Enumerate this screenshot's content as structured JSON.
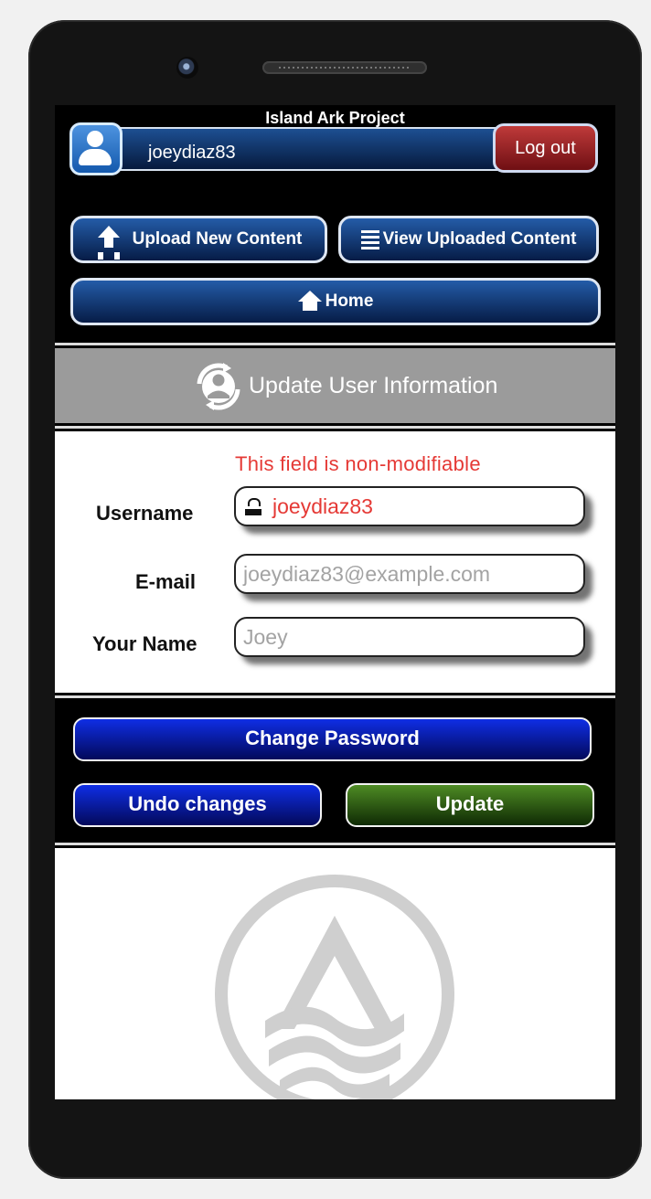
{
  "app": {
    "title": "Island Ark Project"
  },
  "header": {
    "username": "joeydiaz83",
    "logout_label": "Log out"
  },
  "nav": {
    "upload_label": "Upload New Content",
    "view_label": "View Uploaded Content",
    "home_label": "Home"
  },
  "section": {
    "title": "Update User Information"
  },
  "form": {
    "note": "This field is non-modifiable",
    "username_label": "Username",
    "username_value": "joeydiaz83",
    "email_label": "E-mail",
    "email_placeholder": "joeydiaz83@example.com",
    "name_label": "Your Name",
    "name_placeholder": "Joey"
  },
  "actions": {
    "change_password": "Change Password",
    "undo": "Undo changes",
    "update": "Update"
  },
  "icons": {
    "avatar": "user-avatar-icon",
    "upload": "upload-icon",
    "list": "list-icon",
    "home": "home-icon",
    "sync": "user-sync-icon",
    "lock": "lock-icon",
    "logo": "island-ark-logo"
  },
  "colors": {
    "accent_blue": "#1a4f95",
    "logout_red": "#b12a2d",
    "warning_red": "#e53935",
    "update_green": "#3f7b1d",
    "gray_header": "#9b9b9b"
  }
}
